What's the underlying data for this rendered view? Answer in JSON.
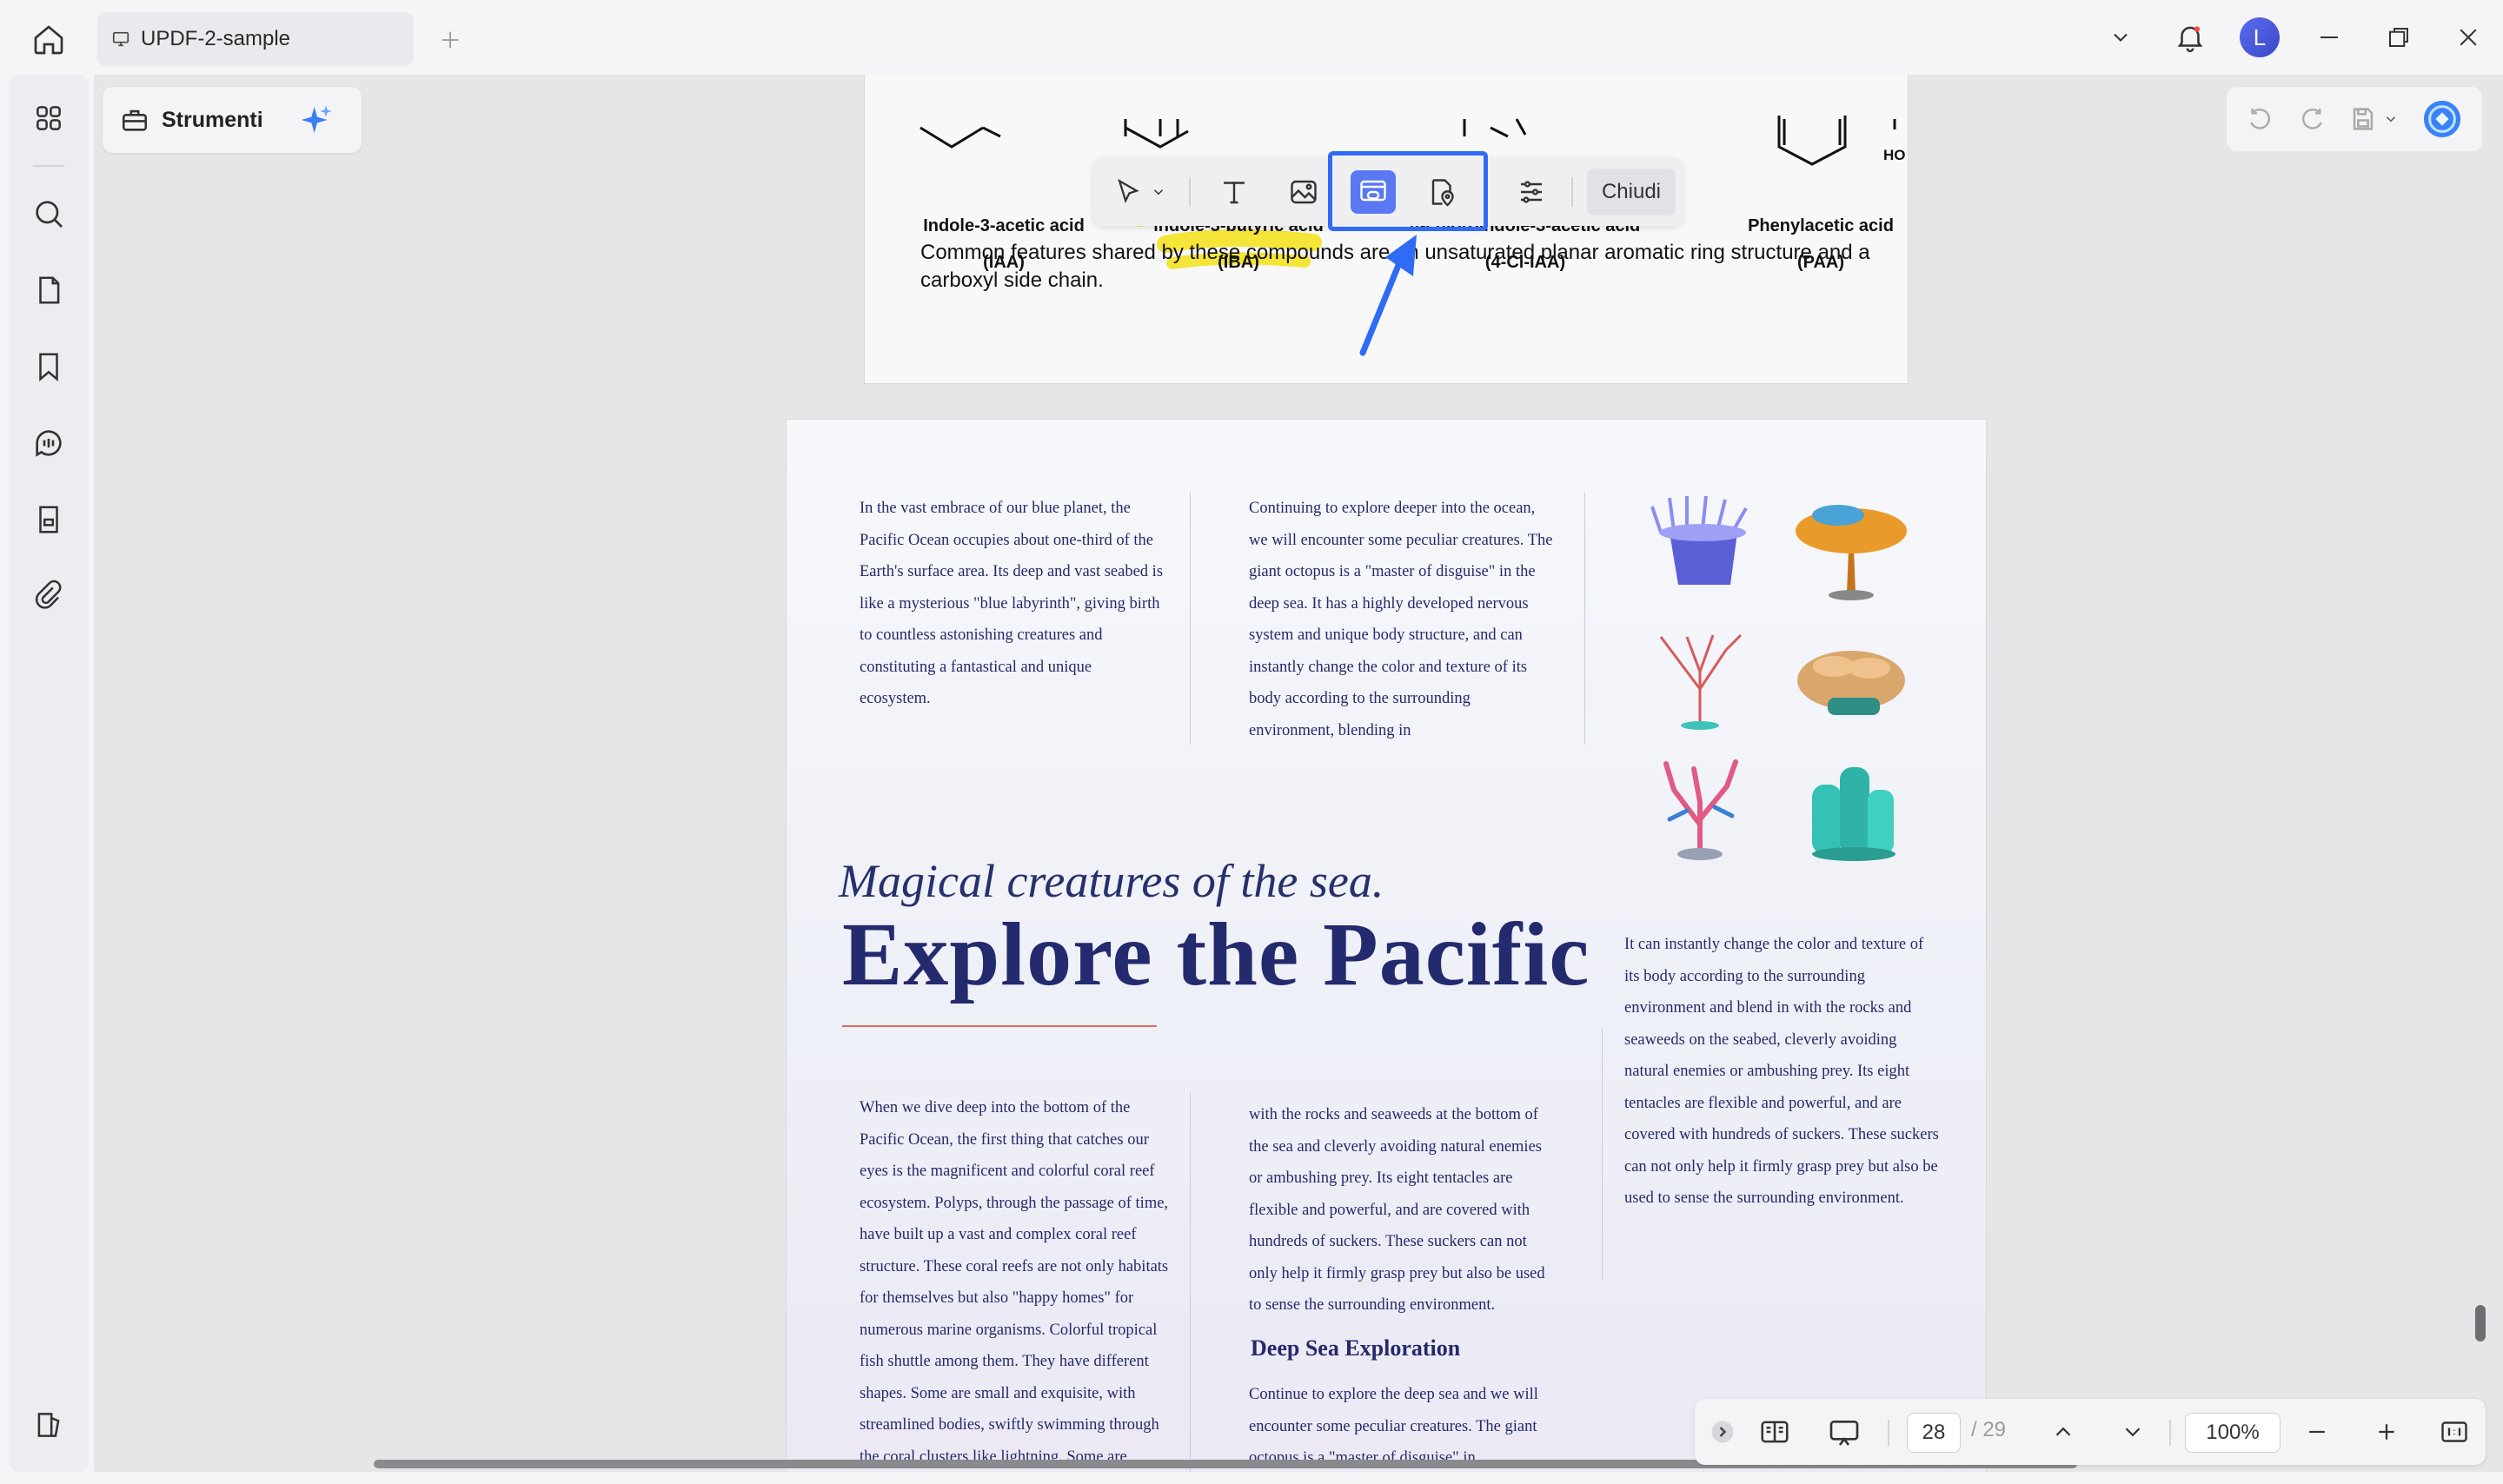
{
  "titlebar": {
    "tab_title": "UPDF-2-sample",
    "avatar_letter": "L"
  },
  "toolbar": {
    "strumenti_label": "Strumenti",
    "chiudi_label": "Chiudi"
  },
  "page_top": {
    "molecules": [
      {
        "name": "Indole-3-acetic acid",
        "abbr": "(IAA)"
      },
      {
        "name": "indole-3-butyric acid",
        "abbr": "(IBA)"
      },
      {
        "name": "4-chloroindole-3-acetic acid",
        "abbr": "(4-Cl-IAA)"
      },
      {
        "name": "Phenylacetic acid",
        "abbr": "(PAA)"
      }
    ],
    "ho_label": "HO",
    "common_text": "Common features shared by these compounds are an unsaturated planar aromatic ring structure and a carboxyl side chain."
  },
  "page_main": {
    "col1_top": "In the vast embrace of our blue planet, the Pacific Ocean occupies about one-third of the Earth's surface area. Its deep and vast seabed is like a mysterious \"blue labyrinth\", giving birth to countless astonishing creatures and constituting a fantastical and unique ecosystem.",
    "col2_top": "Continuing to explore deeper into the ocean, we will encounter some peculiar creatures. The giant octopus is a \"master of disguise\" in the deep sea. It has a highly developed nervous system and unique body structure, and can instantly change the color and texture of its body according to the surrounding environment, blending in",
    "subtitle": "Magical creatures of the sea.",
    "title": "Explore the Pacific",
    "col3_mid": "It can instantly change the color and texture of its body according to the surrounding environment and blend in with the rocks and seaweeds on the seabed, cleverly avoiding natural enemies or ambushing prey. Its eight tentacles are flexible and powerful, and are covered with hundreds of suckers. These suckers can not only help it firmly grasp prey but also be used to sense the surrounding environment.",
    "col1_bottom": "When we dive deep into the bottom of the Pacific Ocean, the first thing that catches our eyes is the magnificent and colorful coral reef ecosystem. Polyps, through the passage of time, have built up a vast and complex coral reef structure. These coral reefs are not only habitats for themselves but also \"happy homes\" for numerous marine organisms. Colorful tropical fish shuttle among them. They have different shapes. Some are small and exquisite, with streamlined bodies, swiftly swimming through the coral clusters like lightning. Some are slightly larger in size, covered",
    "col2_bottom": "with the rocks and seaweeds at the bottom of the sea and cleverly avoiding natural enemies or ambushing prey. Its eight tentacles are flexible and powerful, and are covered with hundreds of suckers. These suckers can not only help it firmly grasp prey but also be used to sense the surrounding environment.",
    "deep_sea_heading": "Deep Sea Exploration",
    "deep_sea_text": "Continue to explore the deep sea and we will encounter some peculiar creatures. The giant octopus is a \"master of disguise\" in"
  },
  "navigation": {
    "current_page": "28",
    "total_pages": "/ 29",
    "zoom": "100%"
  },
  "colors": {
    "accent": "#2f6bf5",
    "active_tool": "#5a78f2",
    "title_navy": "#232a6e"
  },
  "icons": [
    "home-icon",
    "monitor-icon",
    "plus-icon",
    "chevron-down-icon",
    "bell-icon",
    "minimize-icon",
    "maximize-icon",
    "close-icon",
    "grid-icon",
    "search-icon",
    "page-icon",
    "bookmark-icon",
    "comment-icon",
    "form-icon",
    "attachment-icon",
    "sidebar-toggle-icon",
    "toolbox-icon",
    "ai-sparkle-icon",
    "undo-icon",
    "redo-icon",
    "save-icon",
    "ai-assistant-icon",
    "select-icon",
    "text-icon",
    "image-icon",
    "link-icon",
    "location-link-icon",
    "settings-sliders-icon",
    "reading-mode-icon",
    "presentation-icon",
    "chevron-up-icon",
    "zoom-out-icon",
    "zoom-in-icon",
    "fit-page-icon"
  ]
}
